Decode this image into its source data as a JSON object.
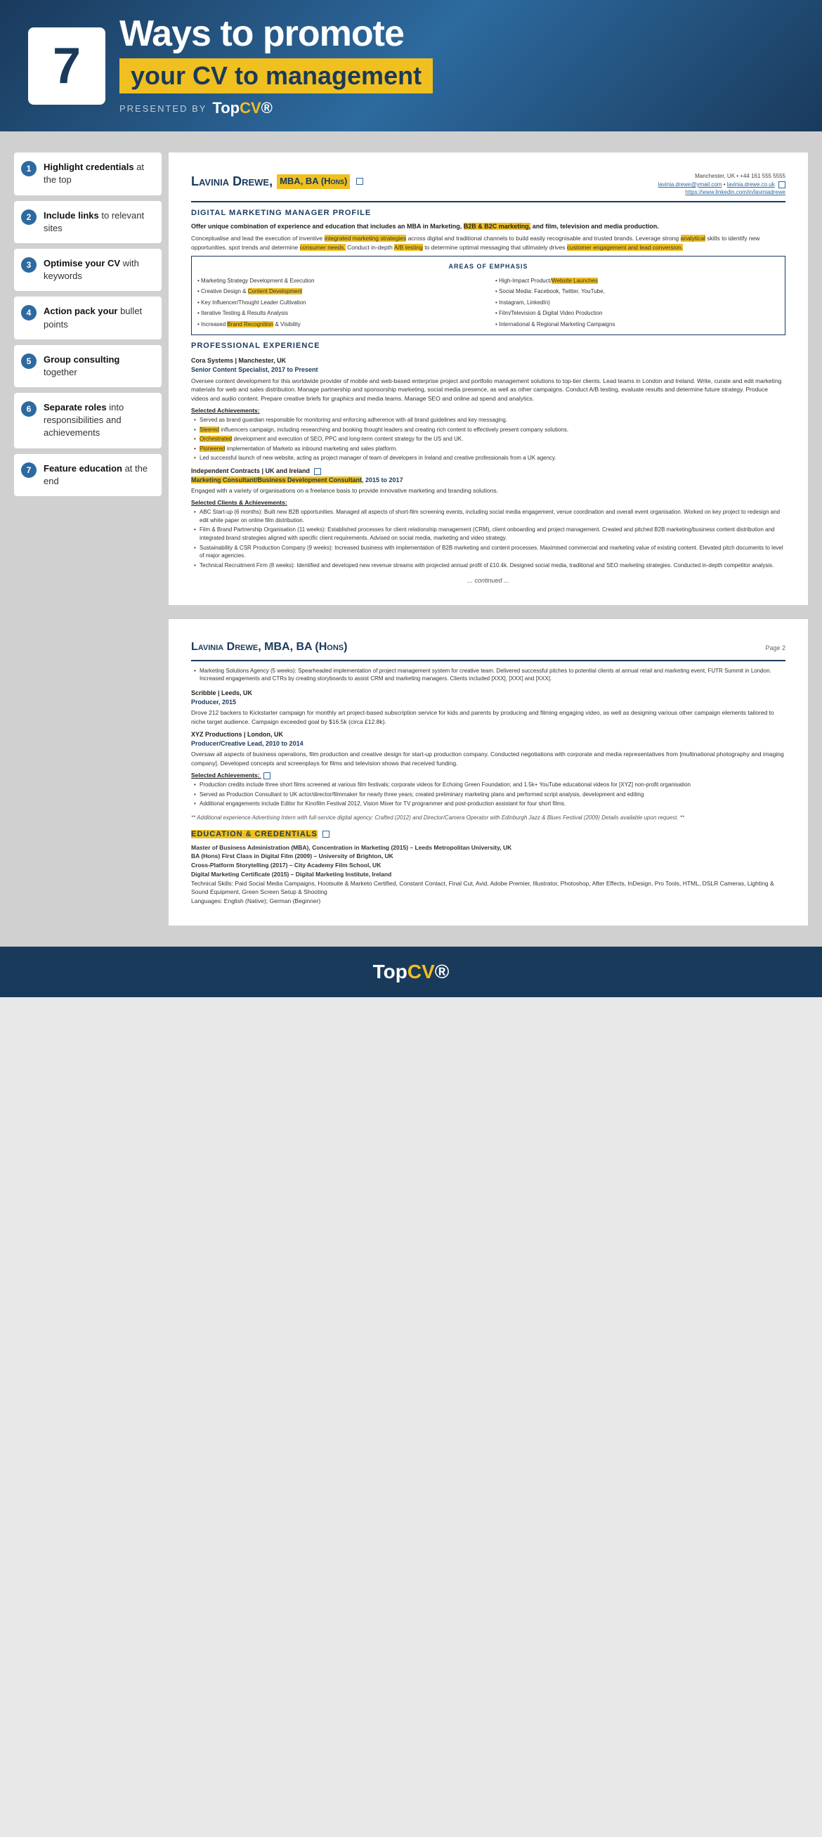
{
  "header": {
    "number": "7",
    "title": "Ways to promote",
    "subtitle": "your CV to management",
    "presented_label": "PRESENTED BY",
    "logo": "TopCV"
  },
  "sidebar": {
    "items": [
      {
        "num": "1",
        "text_bold": "Highlight credentials",
        "text_rest": " at the top"
      },
      {
        "num": "2",
        "text_bold": "Include links",
        "text_rest": " to relevant sites"
      },
      {
        "num": "3",
        "text_bold": "Optimise your CV",
        "text_rest": " with keywords"
      },
      {
        "num": "4",
        "text_bold": "Action pack your",
        "text_rest": " bullet points"
      },
      {
        "num": "5",
        "text_bold": "Group consulting",
        "text_rest": " together"
      },
      {
        "num": "6",
        "text_bold": "Separate roles",
        "text_rest": " into responsibilities and achievements"
      },
      {
        "num": "7",
        "text_bold": "Feature education",
        "text_rest": " at the end"
      }
    ]
  },
  "cv_page1": {
    "name": "Lavinia Drewe,",
    "name_badge": "MBA, BA (Hons)",
    "contact_line1": "Manchester, UK • +44 161 555 5555",
    "contact_line2": "lavinia.drewe@ymail.com • lavinia.drewe.co.uk",
    "contact_line3": "https://www.linkedin.com/in/laviniadrewe",
    "profile_title": "Digital Marketing Manager Profile",
    "profile_intro": "Offer unique combination of experience and education that includes an MBA in Marketing, B2B & B2C marketing, and film, television and media production.",
    "profile_body": "Conceptualise and lead the execution of inventive integrated marketing strategies across digital and traditional channels to build easily recognisable and trusted brands. Leverage strong analytical skills to identify new opportunities, spot trends and determine consumer needs. Conduct in-depth A/B testing to determine optimal messaging that ultimately drives customer engagement and lead conversion.",
    "areas_title": "Areas of Emphasis",
    "areas": [
      "Marketing Strategy Development & Execution",
      "High-Impact Product/Website Launches",
      "Creative Design & Content Development",
      "Social Media: Facebook, Twitter, YouTube,",
      "Key Influencer/Thought Leader Cultivation",
      "Instagram, LinkedIn)",
      "Iterative Testing & Results Analysis",
      "Film/Television & Digital Video Production",
      "Increased Brand Recognition & Visibility",
      "International & Regional Marketing Campaigns"
    ],
    "exp_title": "Professional Experience",
    "exp1_company": "Cora Systems | Manchester, UK",
    "exp1_role": "Senior Content Specialist, 2017 to Present",
    "exp1_desc": "Oversee content development for this worldwide provider of mobile and web-based enterprise project and portfolio management solutions to top-tier clients. Lead teams in London and Ireland. Write, curate and edit marketing materials for web and sales distribution. Manage partnership and sponsorship marketing, social media presence, as well as other campaigns. Conduct A/B testing, evaluate results and determine future strategy. Produce videos and audio content. Prepare creative briefs for graphics and media teams. Manage SEO and online ad spend and analytics.",
    "exp1_achievements_title": "Selected Achievements:",
    "exp1_bullets": [
      "Served as brand guardian responsible for monitoring and enforcing adherence with all brand guidelines and key messaging.",
      "Steered influencers campaign, including researching and booking thought leaders and creating rich content to effectively present company solutions.",
      "Orchestrated development and execution of SEO, PPC and long-term content strategy for the US and UK.",
      "Pioneered implementation of Marketo as inbound marketing and sales platform.",
      "Led successful launch of new website, acting as project manager of team of developers in Ireland and creative professionals from a UK agency."
    ],
    "exp2_company": "Independent Contracts | UK and Ireland",
    "exp2_role": "Marketing Consultant/Business Development Consultant, 2015 to 2017",
    "exp2_desc": "Engaged with a variety of organisations on a freelance basis to provide innovative marketing and branding solutions.",
    "exp2_achievements_title": "Selected Clients & Achievements:",
    "exp2_bullets": [
      "ABC Start-up (6 months): Built new B2B opportunities. Managed all aspects of short-film screening events, including social media engagement, venue coordination and overall event organisation. Worked on key project to redesign and edit white paper on online film distribution.",
      "Film & Brand Partnership Organisation (11 weeks): Established processes for client relationship management (CRM), client onboarding and project management. Created and pitched B2B marketing/business content distribution and integrated brand strategies aligned with specific client requirements. Advised on social media, marketing and video strategy.",
      "Sustainability & CSR Production Company (9 weeks): Increased business with implementation of B2B marketing and content processes. Maximised commercial and marketing value of existing content. Elevated pitch documents to level of major agencies.",
      "Technical Recruitment Firm (8 weeks): Identified and developed new revenue streams with projected annual profit of £10.4k. Designed social media, traditional and SEO marketing strategies. Conducted in-depth competitor analysis."
    ],
    "continued": "... continued ..."
  },
  "cv_page2": {
    "name": "Lavinia Drewe, MBA, BA (Hons)",
    "page_num": "Page 2",
    "bullets_continued": [
      "Marketing Solutions Agency (5 weeks): Spearheaded implementation of project management system for creative team. Delivered successful pitches to potential clients at annual retail and marketing event, FUTR Summit in London. Increased engagements and CTRs by creating storyboards to assist CRM and marketing managers. Clients included [XXX], [XXX] and [XXX]."
    ],
    "scribble_company": "Scribble | Leeds, UK",
    "scribble_role": "Producer, 2015",
    "scribble_desc": "Drove 212 backers to Kickstarter campaign for monthly art project-based subscription service for kids and parents by producing and filming engaging video, as well as designing various other campaign elements tailored to niche target audience. Campaign exceeded goal by $16.5k (circa £12.8k).",
    "xyz_company": "XYZ Productions | London, UK",
    "xyz_role": "Producer/Creative Lead, 2010 to 2014",
    "xyz_desc": "Oversaw all aspects of business operations, film production and creative design for start-up production company. Conducted negotiations with corporate and media representatives from [multinational photography and imaging company]. Developed concepts and screenplays for films and television shows that received funding.",
    "xyz_achievements_title": "Selected Achievements:",
    "xyz_bullets": [
      "Production credits include three short films screened at various film festivals; corporate videos for Echoing Green Foundation; and 1.5k+ YouTube educational videos for [XYZ] non-profit organisation",
      "Served as Production Consultant to UK actor/director/filmmaker for nearly three years; created preliminary marketing plans and performed script analysis, development and editing",
      "Additional engagements include Editor for Kinofilm Festival 2012, Vision Mixer for TV programmer and post-production assistant for four short films."
    ],
    "additional_note": "** Additional experience Advertising Intern with full-service digital agency: Crafted (2012) and Director/Camera Operator with Edinburgh Jazz & Blues Festival (2009) Details available upon request. **",
    "edu_title": "Education & Credentials",
    "edu_items": [
      "Master of Business Administration (MBA), Concentration in Marketing (2015) – Leeds Metropolitan University, UK",
      "BA (Hons) First Class in Digital Film (2009) – University of Brighton, UK",
      "Cross-Platform Storytelling (2017) – City Academy Film School, UK",
      "Digital Marketing Certificate (2015) – Digital Marketing Institute, Ireland",
      "Technical Skills: Paid Social Media Campaigns, Hootsuite & Marketo Certified, Constant Contact, Final Cut, Avid, Adobe Premier, Illustrator, Photoshop, After Effects, InDesign, Pro Tools, HTML, DSLR Cameras, Lighting & Sound Equipment, Green Screen Setup & Shooting",
      "Languages: English (Native); German (Beginner)"
    ]
  },
  "footer": {
    "logo": "TopCV"
  }
}
